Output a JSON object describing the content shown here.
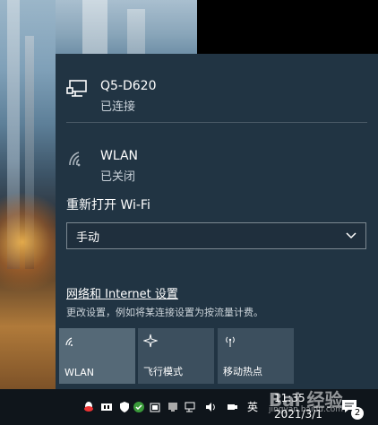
{
  "networks": [
    {
      "name": "Q5-D620",
      "status": "已连接",
      "icon": "ethernet-icon"
    },
    {
      "name": "WLAN",
      "status": "已关闭",
      "icon": "wifi-icon"
    }
  ],
  "wifi": {
    "reopen_label": "重新打开 Wi-Fi",
    "dropdown_value": "手动"
  },
  "settings": {
    "link": "网络和 Internet 设置",
    "description": "更改设置，例如将某连接设置为按流量计费。"
  },
  "quick_actions": [
    {
      "label": "WLAN",
      "icon": "wifi-icon",
      "active": true
    },
    {
      "label": "飞行模式",
      "icon": "airplane-icon",
      "active": false
    },
    {
      "label": "移动热点",
      "icon": "hotspot-icon",
      "active": false
    }
  ],
  "taskbar": {
    "ime": "英",
    "time": "11:35",
    "date": "2021/3/1",
    "notification_count": "2",
    "icons": [
      "qq-icon",
      "app-icon",
      "shield-icon",
      "security-icon",
      "battery-icon",
      "display-icon",
      "network-icon",
      "volume-icon",
      "usb-icon"
    ]
  },
  "watermark": {
    "brand": "Bai 经验",
    "url": "jingyan.baidu.com"
  },
  "colors": {
    "flyout_bg": "#213443",
    "tile_active": "#556977",
    "tile": "#3c4f5e",
    "taskbar": "#0f151b"
  }
}
